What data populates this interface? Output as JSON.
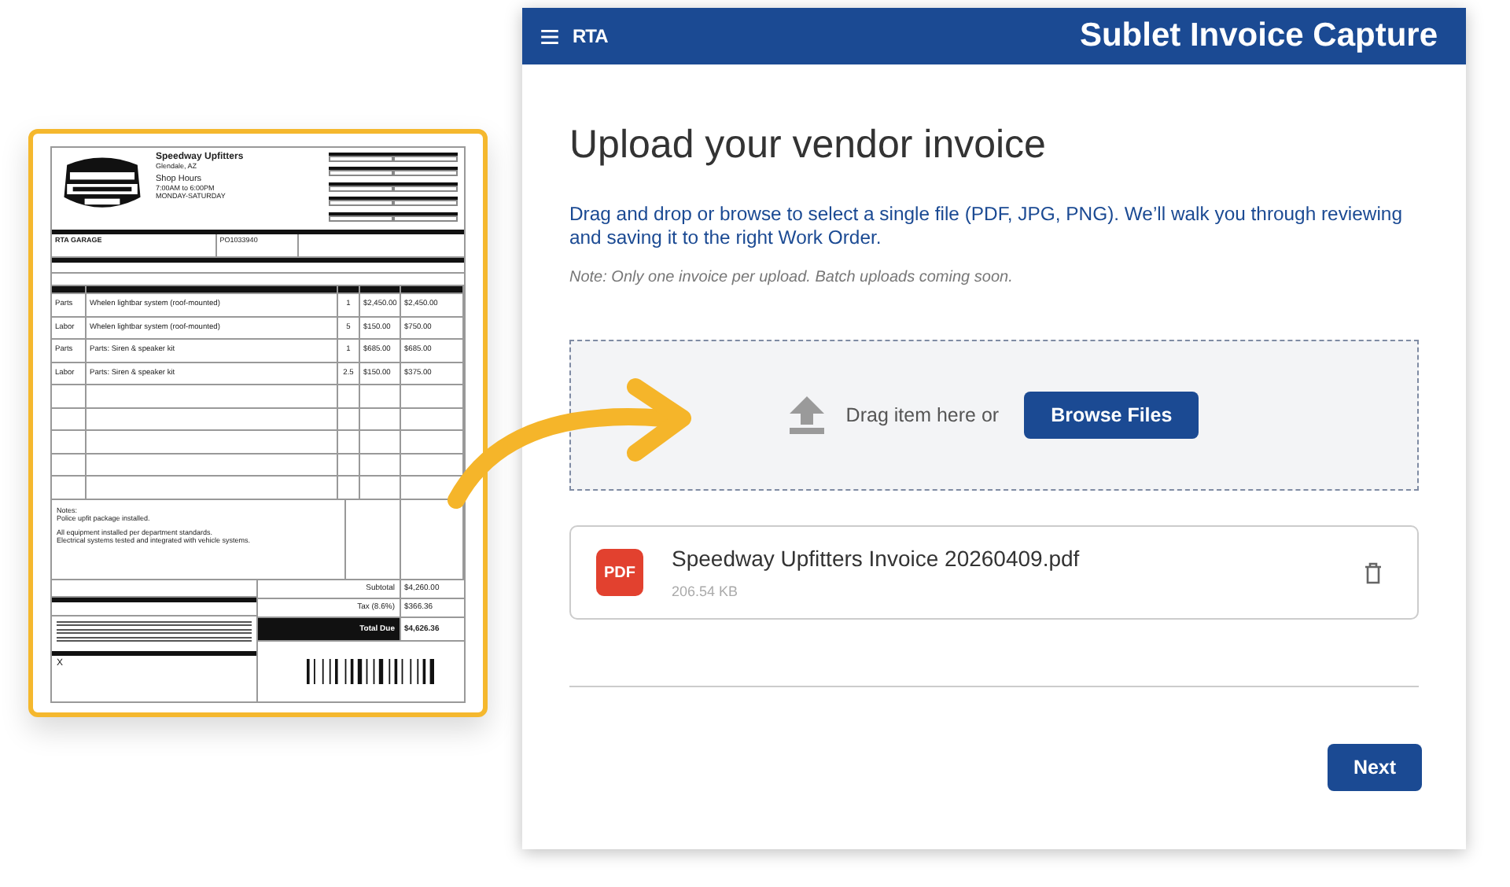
{
  "invoice": {
    "vendor": "Speedway Upfitters",
    "location": "Glendale, AZ",
    "hours_label": "Shop Hours",
    "hours": "7:00AM to 6:00PM",
    "days": "MONDAY-SATURDAY",
    "customer": "RTA GARAGE",
    "po": "PO1033940",
    "items": [
      {
        "type": "Parts",
        "description": "Whelen lightbar system (roof-mounted)",
        "qty": "1",
        "unit": "$2,450.00",
        "total": "$2,450.00"
      },
      {
        "type": "Labor",
        "description": "Whelen lightbar system (roof-mounted)",
        "qty": "5",
        "unit": "$150.00",
        "total": "$750.00"
      },
      {
        "type": "Parts",
        "description": "Parts: Siren & speaker kit",
        "qty": "1",
        "unit": "$685.00",
        "total": "$685.00"
      },
      {
        "type": "Labor",
        "description": "Parts: Siren & speaker kit",
        "qty": "2.5",
        "unit": "$150.00",
        "total": "$375.00"
      }
    ],
    "notes_label": "Notes:",
    "notes": [
      "Police upfit package installed.",
      "All equipment installed per department standards.",
      "Electrical systems tested and integrated with vehicle systems."
    ],
    "totals": [
      {
        "label": "Subtotal",
        "value": "$4,260.00",
        "kind": "plain"
      },
      {
        "label": "Tax (8.6%)",
        "value": "$366.36",
        "kind": "plain"
      },
      {
        "label": "Total Due",
        "value": "$4,626.36",
        "kind": "grand"
      }
    ],
    "signature": "X"
  },
  "app": {
    "brand": "RTA",
    "title": "Sublet Invoice Capture",
    "heading": "Upload your vendor invoice",
    "description": "Drag and drop or browse to select a single file (PDF, JPG, PNG). We’ll walk you through reviewing and saving it to the right Work Order.",
    "note": "Note: Only one invoice per upload. Batch uploads coming soon.",
    "dropzone": {
      "text": "Drag item here or",
      "button": "Browse Files"
    },
    "file": {
      "badge": "PDF",
      "name": "Speedway Upfitters Invoice 20260409.pdf",
      "size": "206.54 KB"
    },
    "next": "Next"
  }
}
